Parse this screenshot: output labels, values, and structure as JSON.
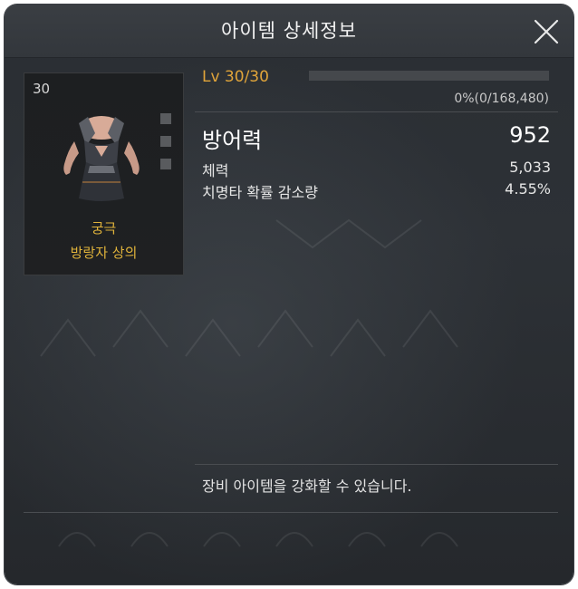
{
  "window": {
    "title": "아이템 상세정보"
  },
  "item": {
    "card_level": "30",
    "grade": "궁극",
    "name": "방랑자 상의",
    "level_text": "Lv 30/30",
    "exp_text": "0%(0/168,480)",
    "exp_progress": 0
  },
  "stats": {
    "main": {
      "label": "방어력",
      "value": "952"
    },
    "rows": [
      {
        "label": "체력",
        "value": "5,033"
      },
      {
        "label": "치명타 확률 감소량",
        "value": "4.55%"
      }
    ]
  },
  "footer": {
    "note": "장비 아이템을 강화할 수 있습니다."
  },
  "colors": {
    "accent": "#e0b33b",
    "level": "#e0a43a",
    "panel": "#2d3136"
  },
  "icons": {
    "close": "close-icon",
    "item": "armor-top-icon"
  }
}
